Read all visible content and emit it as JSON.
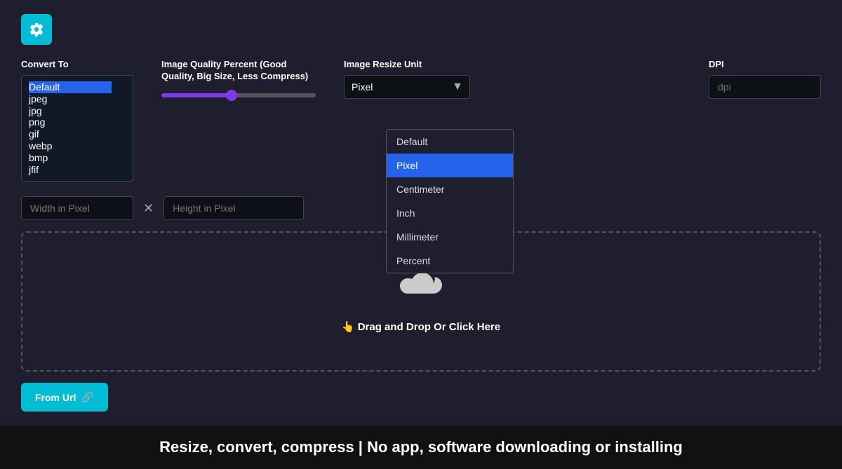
{
  "gear_button": "⚙",
  "convert_to": {
    "label": "Convert To",
    "selected": "Default",
    "options": [
      "Default",
      "jpeg",
      "jpg",
      "png",
      "gif",
      "webp",
      "bmp",
      "jfif"
    ]
  },
  "quality": {
    "label": "Image Quality Percent (Good Quality, Big Size, Less Compress)",
    "value": 45
  },
  "resize_unit": {
    "label": "Image Resize Unit",
    "selected": "Pixel",
    "options": [
      "Default",
      "Pixel",
      "Centimeter",
      "Inch",
      "Millimeter",
      "Percent"
    ]
  },
  "dpi": {
    "label": "DPI",
    "placeholder": "dpi"
  },
  "width_placeholder": "Width in Pixel",
  "height_placeholder": "Height in Pixel",
  "upload": {
    "icon": "☁",
    "text": "👆 Drag and Drop Or Click Here"
  },
  "from_url": {
    "label": "From Url",
    "icon": "🔗"
  },
  "footer": {
    "text": "Resize, convert, compress | No app, software downloading or installing"
  }
}
